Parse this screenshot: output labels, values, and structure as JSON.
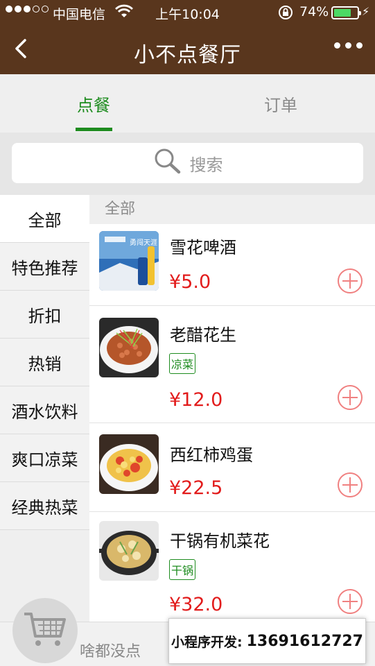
{
  "status": {
    "carrier": "中国电信",
    "time": "上午10:04",
    "battery_pct": "74%",
    "battery_level": 0.74
  },
  "nav": {
    "title": "小不点餐厅"
  },
  "tabs": [
    {
      "label": "点餐",
      "active": true
    },
    {
      "label": "订单",
      "active": false
    }
  ],
  "search": {
    "placeholder": "搜索"
  },
  "sidebar": {
    "items": [
      {
        "label": "全部",
        "active": true
      },
      {
        "label": "特色推荐"
      },
      {
        "label": "折扣"
      },
      {
        "label": "热销"
      },
      {
        "label": "酒水饮料"
      },
      {
        "label": "爽口凉菜"
      },
      {
        "label": "经典热菜"
      }
    ]
  },
  "section": {
    "title": "全部"
  },
  "products": [
    {
      "name": "雪花啤酒",
      "price": "¥5.0",
      "tag": null,
      "image": "beer-image"
    },
    {
      "name": "老醋花生",
      "price": "¥12.0",
      "tag": "凉菜",
      "image": "peanut-dish-image"
    },
    {
      "name": "西红柿鸡蛋",
      "price": "¥22.5",
      "tag": null,
      "image": "tomato-egg-dish-image"
    },
    {
      "name": "干锅有机菜花",
      "price": "¥32.0",
      "tag": "干锅",
      "image": "cauliflower-pot-image"
    }
  ],
  "cart": {
    "empty_text": "啥都没点"
  },
  "promo": {
    "label": "小程序开发:",
    "phone": "13691612727"
  },
  "colors": {
    "nav_bg": "#59361d",
    "accent_green": "#1e8c1f",
    "price_red": "#e21c1c",
    "add_icon": "#f08080"
  }
}
